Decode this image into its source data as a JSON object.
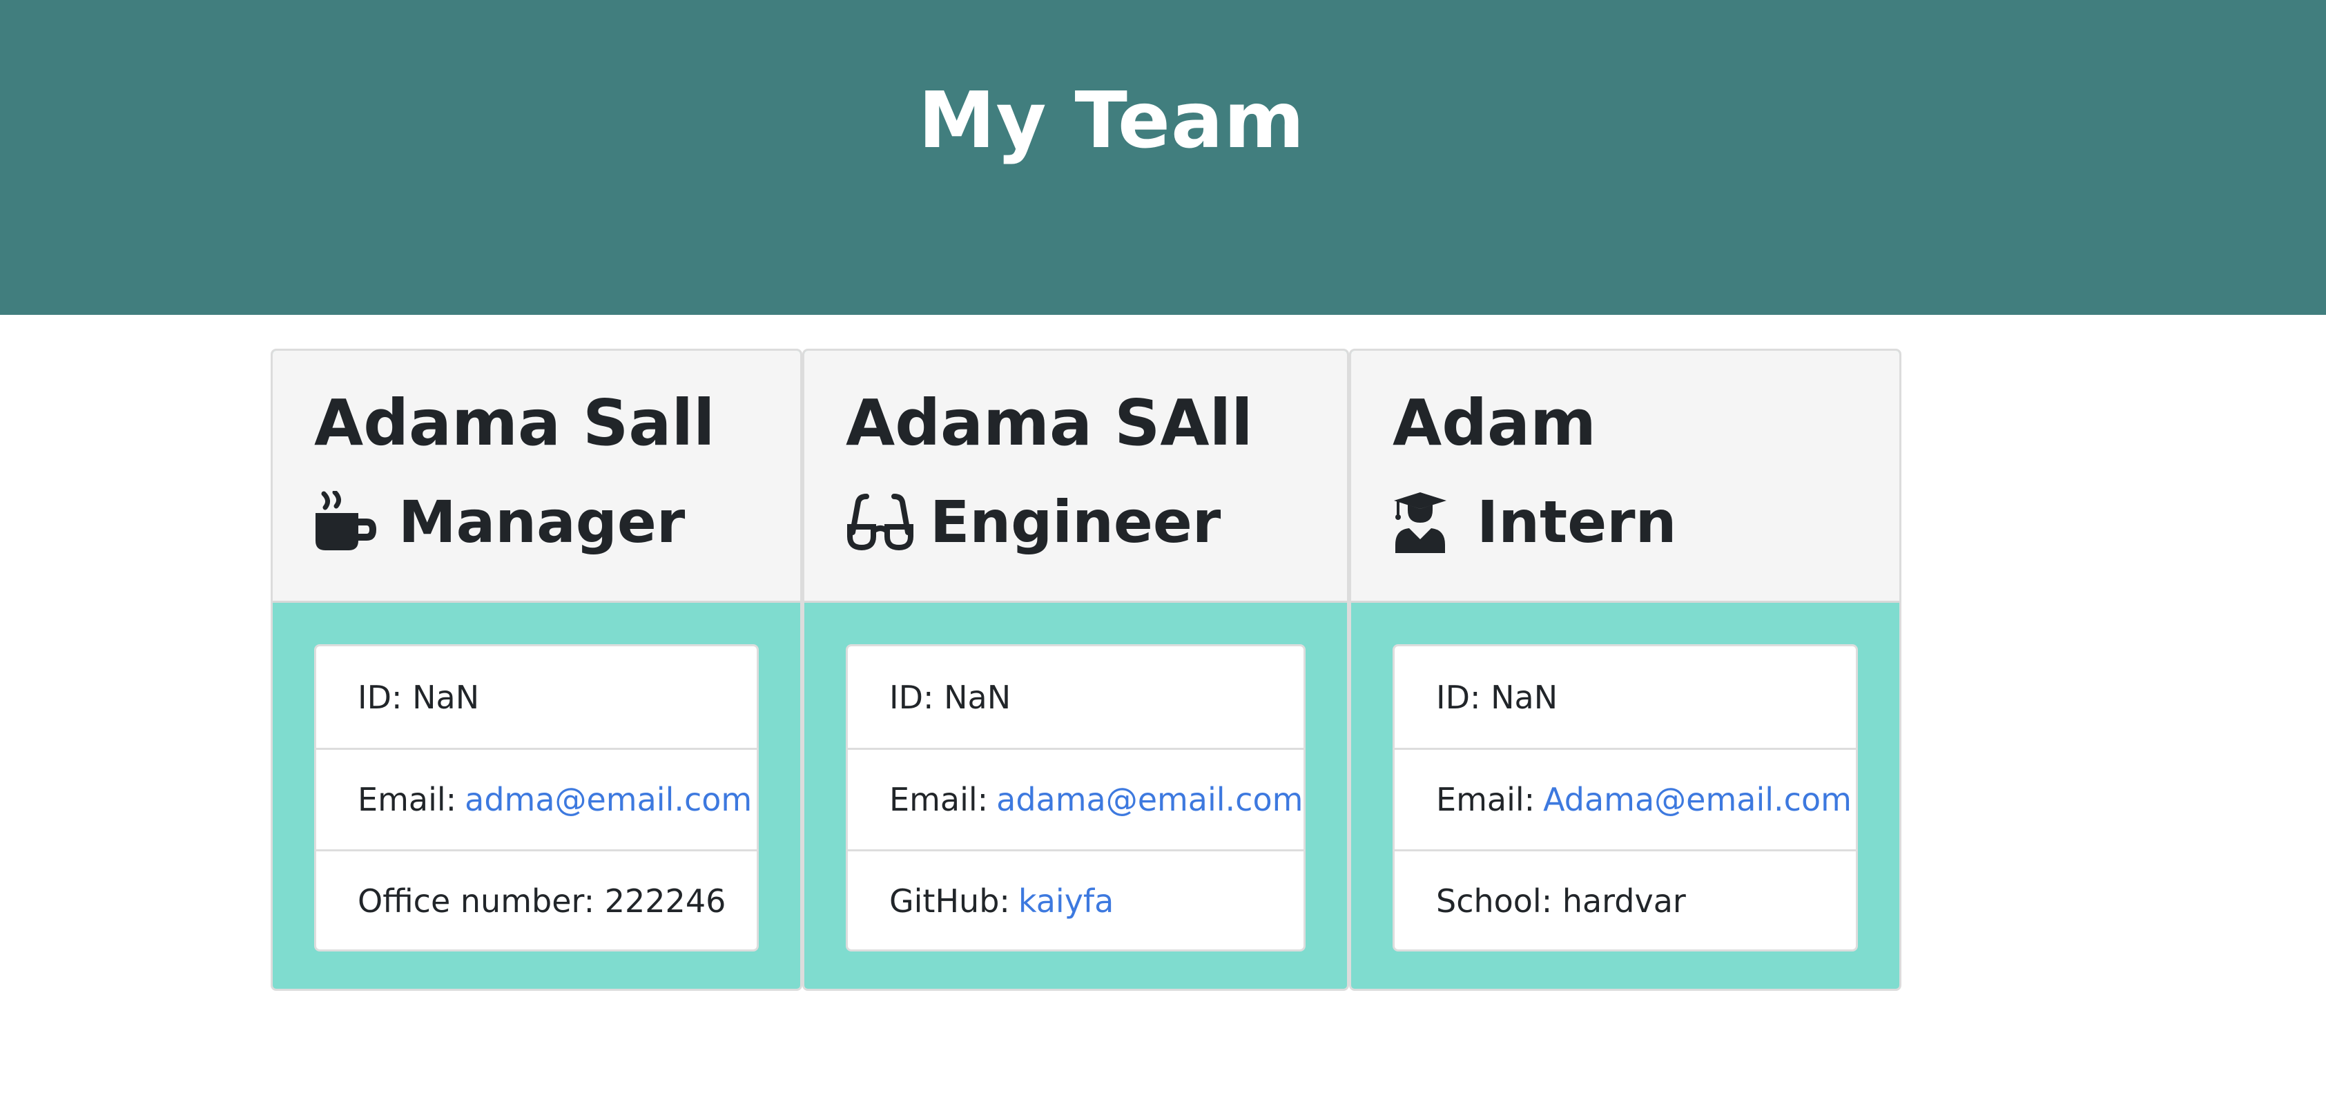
{
  "header": {
    "title": "My Team"
  },
  "colors": {
    "header_bg": "#417e7e",
    "card_body_bg": "#7fdccf",
    "link": "#3d79df"
  },
  "cards": [
    {
      "name": "Adama Sall",
      "role": "Manager",
      "icon": "coffee-mug-icon",
      "id_label": "ID:",
      "id_value": "NaN",
      "email_label": "Email:",
      "email": "adma@email.com",
      "extra_label": "Office number:",
      "extra_value": "222246"
    },
    {
      "name": "Adama SAll",
      "role": "Engineer",
      "icon": "glasses-icon",
      "id_label": "ID:",
      "id_value": "NaN",
      "email_label": "Email:",
      "email": "adama@email.com",
      "extra_label": "GitHub:",
      "extra_value": "kaiyfa"
    },
    {
      "name": "Adam",
      "role": "Intern",
      "icon": "graduate-icon",
      "id_label": "ID:",
      "id_value": "NaN",
      "email_label": "Email:",
      "email": "Adama@email.com",
      "extra_label": "School:",
      "extra_value": "hardvar"
    }
  ]
}
